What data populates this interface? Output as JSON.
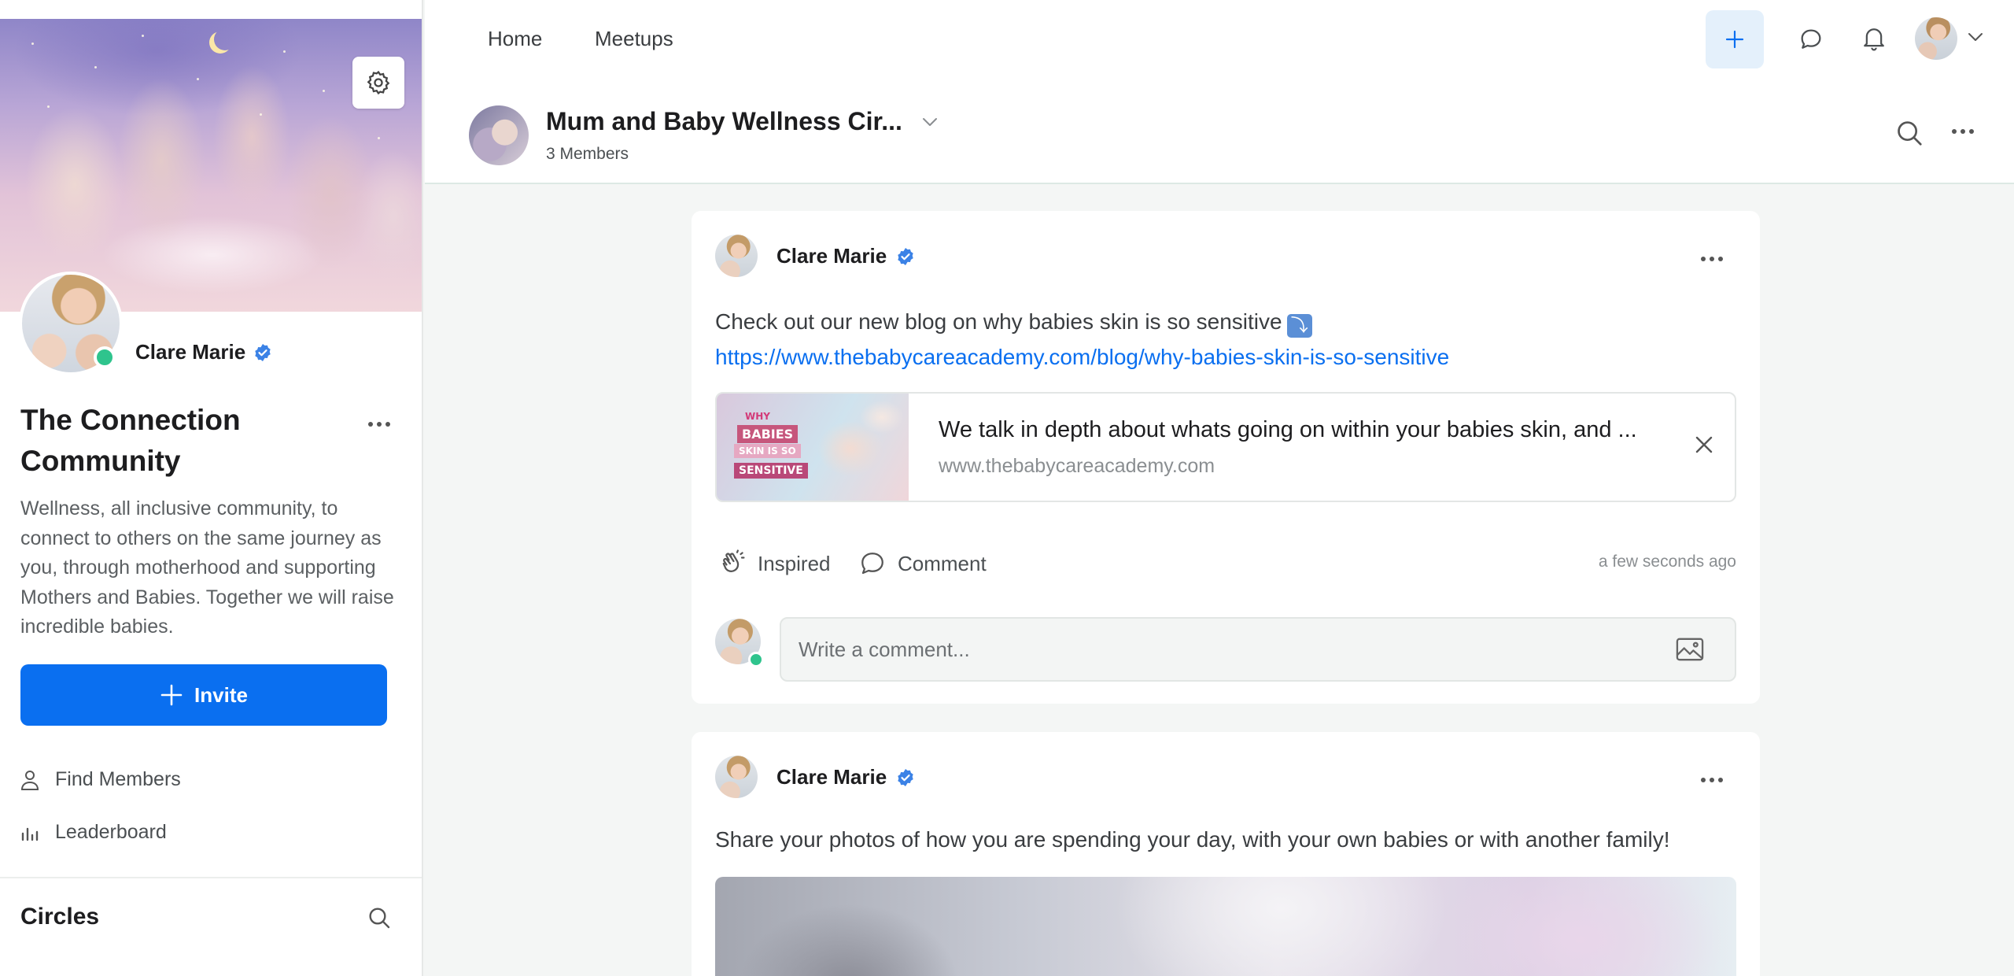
{
  "sidebar": {
    "profile_name": "Clare Marie",
    "community_title": "The Connection Community",
    "community_description": "Wellness, all inclusive community, to connect to others on the same journey as you, through motherhood and supporting Mothers and Babies. Together we will raise incredible babies.",
    "invite_label": "Invite",
    "links": [
      {
        "label": "Find Members",
        "icon": "person-icon"
      },
      {
        "label": "Leaderboard",
        "icon": "bar-chart-icon"
      }
    ],
    "circles_title": "Circles"
  },
  "nav": {
    "items": [
      "Home",
      "Meetups"
    ]
  },
  "circle": {
    "name": "Mum and Baby Wellness Cir...",
    "members": "3 Members"
  },
  "posts": [
    {
      "author": "Clare Marie",
      "text": "Check out our new blog on why babies skin is so sensitive",
      "emoji": "⤵",
      "link": "https://www.thebabycareacademy.com/blog/why-babies-skin-is-so-sensitive",
      "preview": {
        "title": "We talk in depth about whats going on within your babies skin, and ...",
        "domain": "www.thebabycareacademy.com",
        "thumb_lines": [
          "WHY",
          "BABIES",
          "SKIN IS SO",
          "SENSITIVE"
        ]
      },
      "actions": {
        "inspired": "Inspired",
        "comment": "Comment"
      },
      "time": "a few seconds ago",
      "comment_placeholder": "Write a comment..."
    },
    {
      "author": "Clare Marie",
      "text": "Share your photos of how you are spending your day, with your own babies or with another family!"
    }
  ],
  "colors": {
    "accent": "#0a6ff0",
    "online": "#2fc48d",
    "verified": "#3b82e6"
  }
}
